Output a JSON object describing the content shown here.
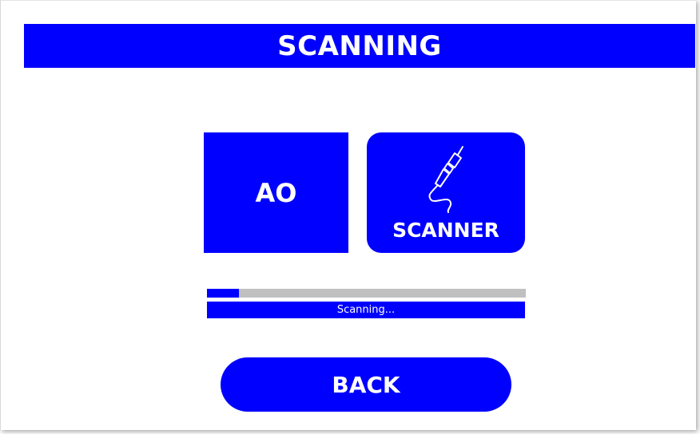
{
  "header": {
    "title": "SCANNING"
  },
  "tiles": {
    "ao": {
      "label": "AO"
    },
    "scanner": {
      "label": "SCANNER",
      "icon": "scanner-probe-icon"
    }
  },
  "progress": {
    "value_percent": 10,
    "status_text": "Scanning..."
  },
  "footer": {
    "back_label": "BACK"
  },
  "colors": {
    "accent": "#0000ff",
    "track": "#c0c0c0",
    "text_on_accent": "#ffffff",
    "background": "#ffffff"
  }
}
